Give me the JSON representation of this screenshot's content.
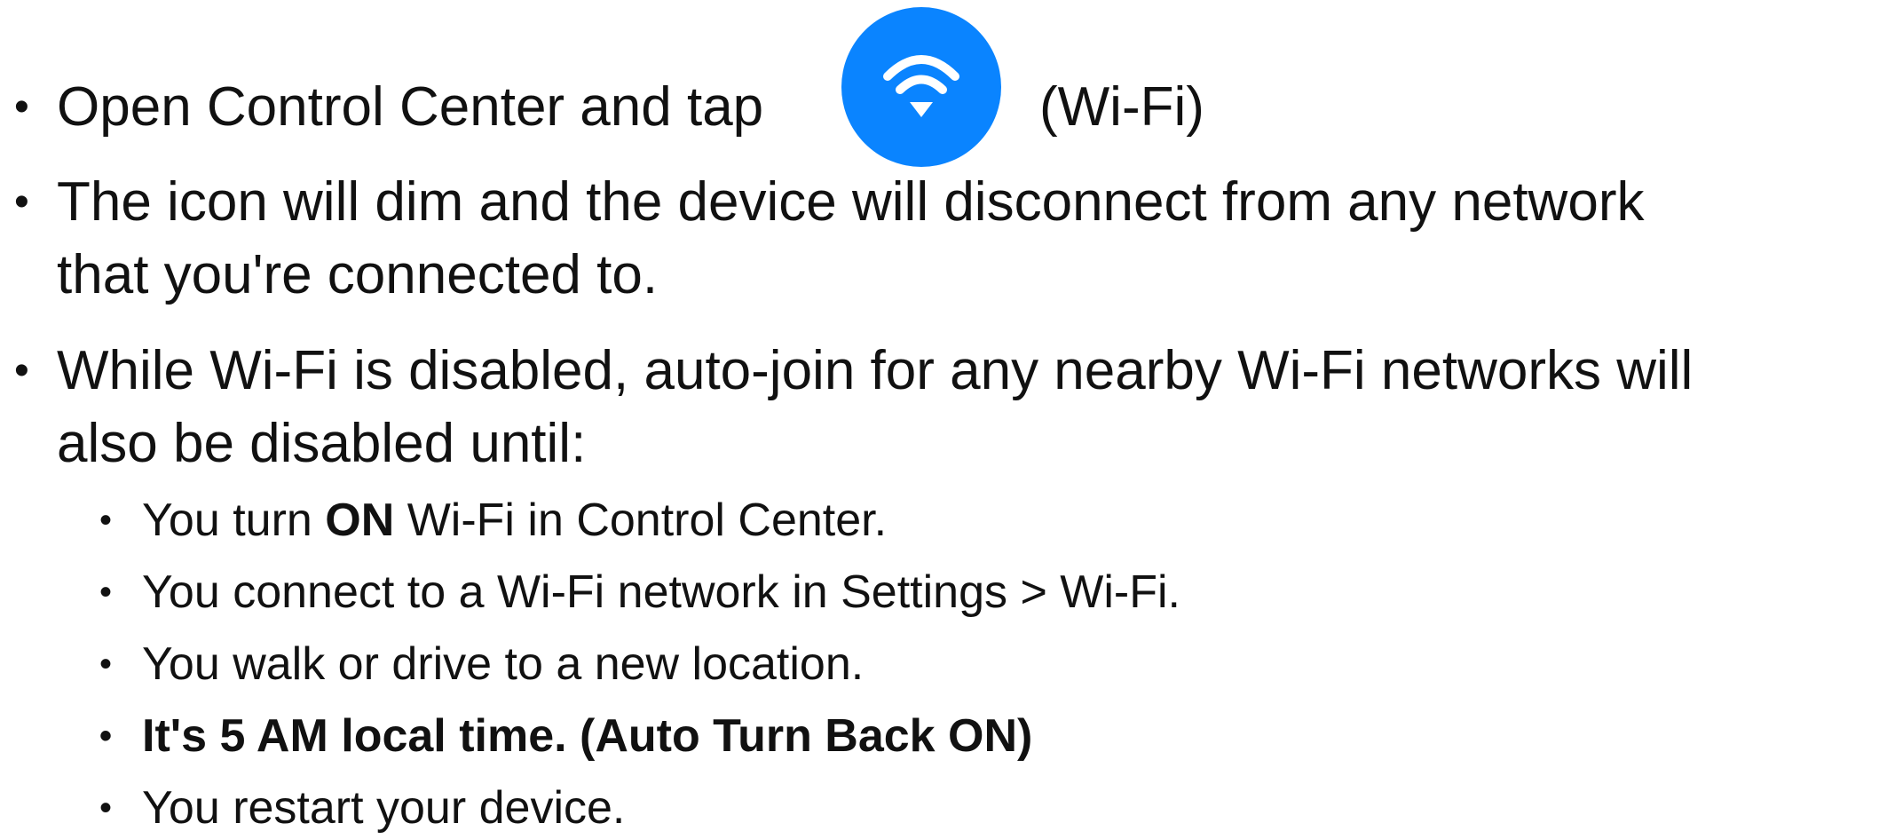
{
  "bullets": {
    "b1": {
      "bullet": "•",
      "before_icon": "Open Control Center and tap",
      "after_icon": "(Wi-Fi)",
      "icon": "wifi-icon",
      "icon_color": "#0a84ff"
    },
    "b2": {
      "bullet": "•",
      "line1": "The icon will dim and the device will disconnect from any network",
      "line2": "that you're connected to."
    },
    "b3": {
      "bullet": "•",
      "line1": "While Wi-Fi is disabled, auto-join for any nearby Wi-Fi networks will",
      "line2": "also be disabled until:"
    }
  },
  "sub_bullets": {
    "s1": {
      "bullet": "•",
      "pre": "You turn ",
      "bold": "ON",
      "post": " Wi-Fi in Control Center."
    },
    "s2": {
      "bullet": "•",
      "text": "You connect to a Wi-Fi network in Settings > Wi-Fi."
    },
    "s3": {
      "bullet": "•",
      "text": "You walk or drive to a new location."
    },
    "s4": {
      "bullet": "•",
      "text": "It's 5 AM local time. (Auto Turn Back ON)"
    },
    "s5": {
      "bullet": "•",
      "text": "You restart your device."
    }
  }
}
